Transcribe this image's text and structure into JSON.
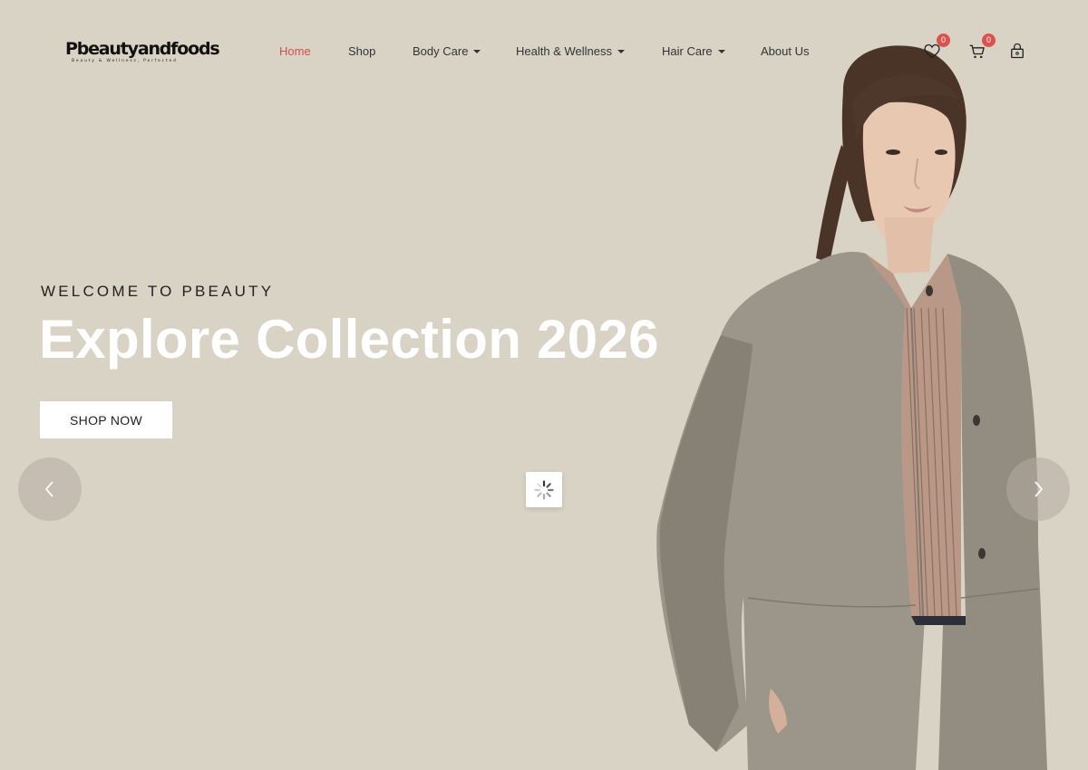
{
  "brand": {
    "logo_text": "Pbeautyandfoods",
    "tagline": "Beauty & Wellness, Perfected"
  },
  "nav": {
    "items": [
      {
        "label": "Home",
        "active": true,
        "dropdown": false
      },
      {
        "label": "Shop",
        "active": false,
        "dropdown": false
      },
      {
        "label": "Body Care",
        "active": false,
        "dropdown": true
      },
      {
        "label": "Health & Wellness",
        "active": false,
        "dropdown": true
      },
      {
        "label": "Hair Care",
        "active": false,
        "dropdown": true
      },
      {
        "label": "About Us",
        "active": false,
        "dropdown": false
      }
    ]
  },
  "header_icons": {
    "wishlist": {
      "icon": "heart-icon",
      "count": "0"
    },
    "cart": {
      "icon": "cart-icon",
      "count": "0"
    },
    "account": {
      "icon": "lock-icon"
    }
  },
  "hero": {
    "kicker": "WELCOME TO PBEAUTY",
    "headline": "Explore Collection 2026",
    "cta_label": "SHOP NOW",
    "prev_icon": "chevron-left-icon",
    "next_icon": "chevron-right-icon",
    "loader_icon": "loading-spinner-icon",
    "image": "model-in-grey-coat"
  },
  "colors": {
    "background": "#d9d3c5",
    "active_nav": "#d04f4f",
    "badge": "#d9534f",
    "headline": "#ffffff"
  }
}
